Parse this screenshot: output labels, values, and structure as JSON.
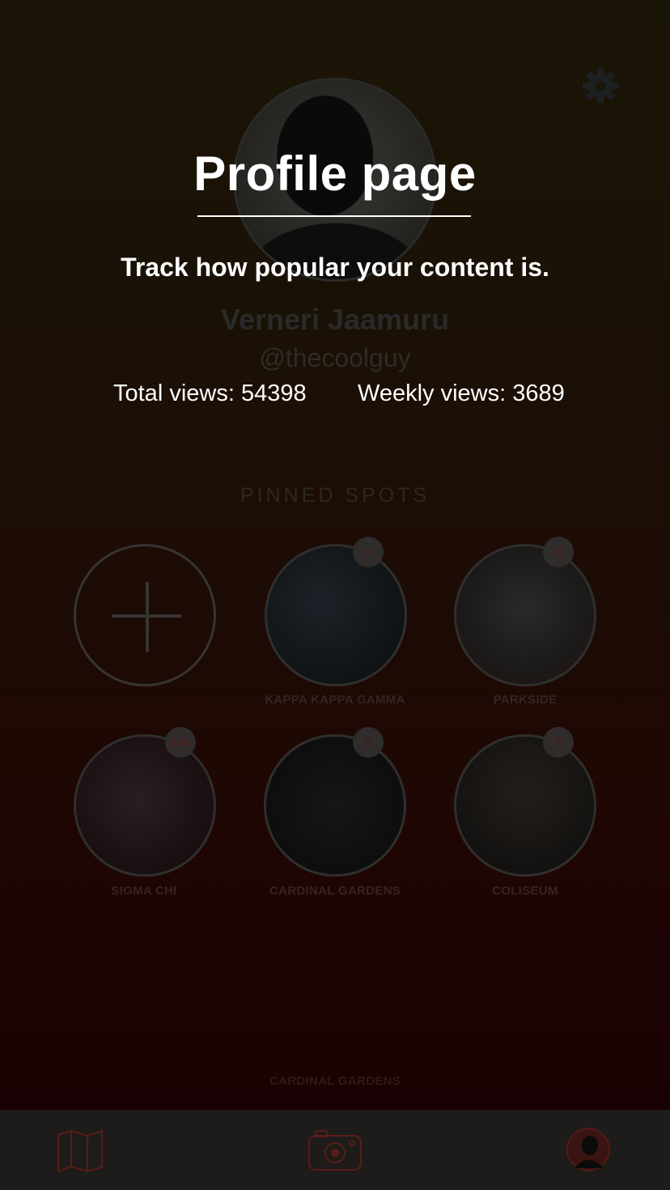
{
  "overlay": {
    "title": "Profile page",
    "subtitle": "Track how popular your content is."
  },
  "profile": {
    "name": "Verneri Jaamuru",
    "handle": "@thecoolguy",
    "total_views_label": "Total views: 54398",
    "weekly_views_label": "Weekly views: 3689"
  },
  "pinned": {
    "title": "PINNED SPOTS",
    "spots": [
      {
        "label": "KAPPA KAPPA GAMMA",
        "badge": "8"
      },
      {
        "label": "PARKSIDE",
        "badge": "8"
      },
      {
        "label": "SIGMA CHI",
        "badge": "100"
      },
      {
        "label": "CARDINAL GARDENS",
        "badge": "8"
      },
      {
        "label": "COLISEUM",
        "badge": "8"
      }
    ],
    "bottom_label": "CARDINAL GARDENS"
  },
  "icons": {
    "settings": "gear-icon",
    "add": "plus-icon",
    "tab_map": "map-icon",
    "tab_camera": "camera-icon",
    "tab_profile": "profile-avatar-icon"
  },
  "colors": {
    "accent": "#7a1a12",
    "background_top": "#1b1507",
    "background_bottom": "#1a0103"
  }
}
